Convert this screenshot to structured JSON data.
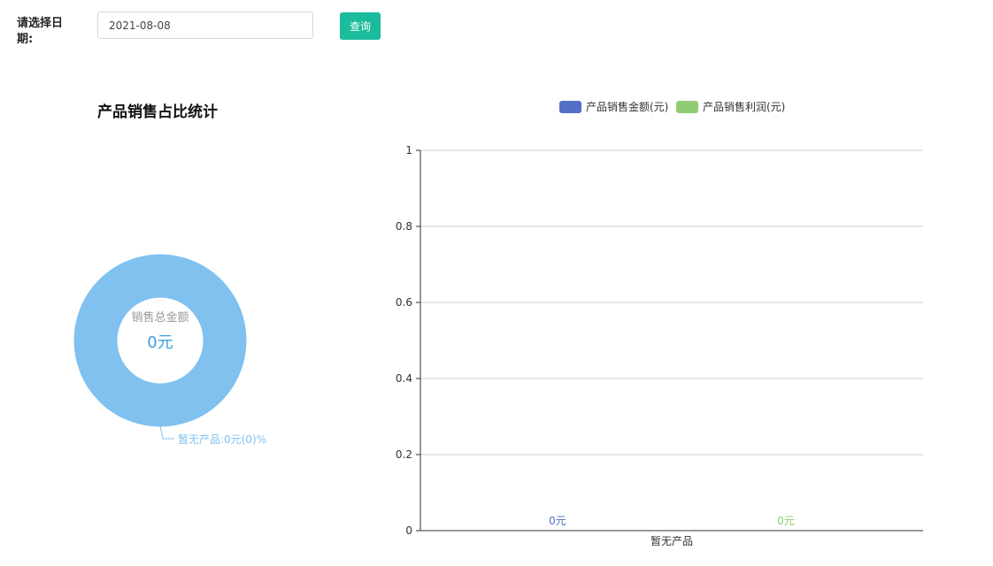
{
  "filter": {
    "label": "请选择日期:",
    "date_value": "2021-08-08",
    "query_label": "查询"
  },
  "section_title": "产品销售占比统计",
  "chart_data": [
    {
      "type": "pie",
      "variant": "donut",
      "center_label": "销售总金额",
      "center_value": "0元",
      "slices": [
        {
          "label": "暂无产品:0元(0)%",
          "value": 0,
          "color": "#80c1f0"
        }
      ],
      "label_color": "#80c1f0",
      "center_value_color": "#3aa0d8"
    },
    {
      "type": "bar",
      "categories": [
        "暂无产品"
      ],
      "series": [
        {
          "name": "产品销售金额(元)",
          "values": [
            0
          ],
          "color": "#5470c6",
          "value_labels": [
            "0元"
          ]
        },
        {
          "name": "产品销售利润(元)",
          "values": [
            0
          ],
          "color": "#91cc75",
          "value_labels": [
            "0元"
          ]
        }
      ],
      "ylim": [
        0,
        1
      ],
      "yticks": [
        "0",
        "0.2",
        "0.4",
        "0.6",
        "0.8",
        "1"
      ],
      "ytick_values": [
        0,
        0.2,
        0.4,
        0.6,
        0.8,
        1
      ],
      "grid": true,
      "legend_position": "top-center"
    }
  ]
}
